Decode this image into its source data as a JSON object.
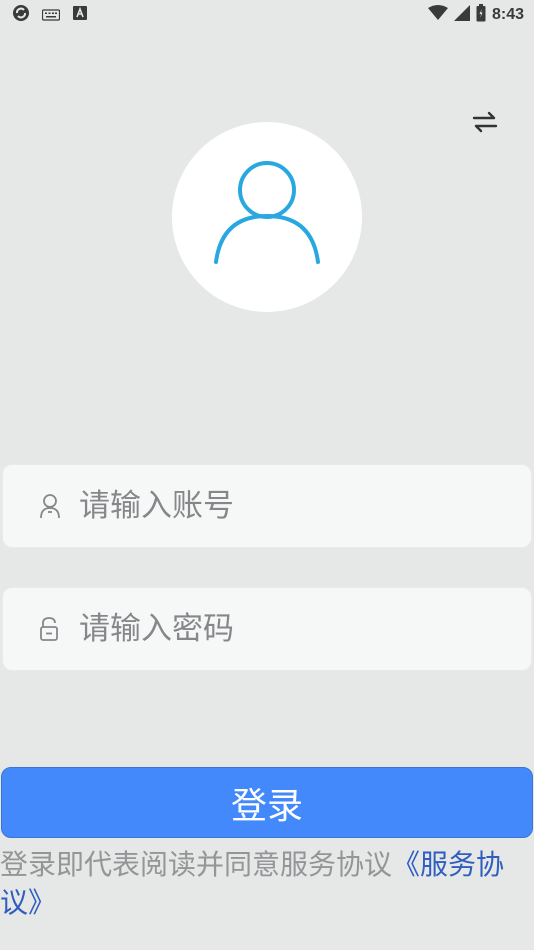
{
  "status_bar": {
    "time": "8:43",
    "left_icons": [
      "sync-icon",
      "keyboard-icon",
      "text-a-icon"
    ],
    "right_icons": [
      "wifi-icon",
      "signal-icon",
      "battery-icon"
    ]
  },
  "header": {
    "switch_icon": "swap-arrows-icon"
  },
  "avatar": {
    "icon": "user-icon",
    "color": "#29a8e0"
  },
  "form": {
    "account": {
      "placeholder": "请输入账号",
      "value": "",
      "icon": "user-outline-icon"
    },
    "password": {
      "placeholder": "请输入密码",
      "value": "",
      "icon": "lock-outline-icon"
    },
    "login_label": "登录"
  },
  "agreement": {
    "prefix": "登录即代表阅读并同意服务协议",
    "link": "《服务协议》"
  },
  "colors": {
    "background": "#e6e7e7",
    "primary": "#4389fb",
    "link": "#2f5ec0",
    "hint": "#939597"
  }
}
